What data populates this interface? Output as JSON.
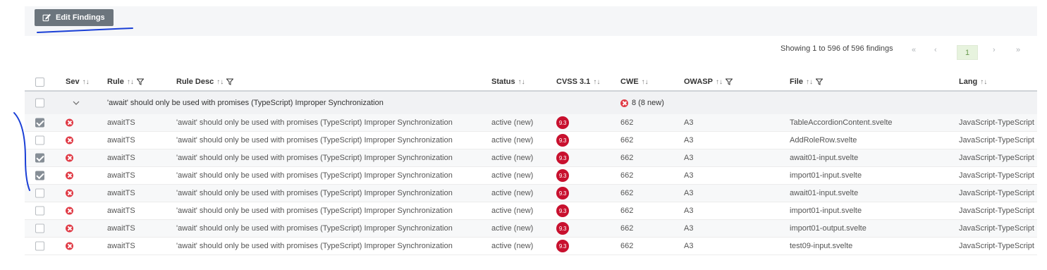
{
  "toolbar": {
    "edit_label": "Edit Findings",
    "edit_icon": "edit-icon"
  },
  "pager": {
    "summary": "Showing 1 to 596 of 596 findings",
    "first": "«",
    "prev": "‹",
    "current": "1",
    "next": "›",
    "last": "»"
  },
  "columns": {
    "sev": "Sev",
    "rule": "Rule",
    "rule_desc": "Rule Desc",
    "status": "Status",
    "cvss": "CVSS 3.1",
    "cwe": "CWE",
    "owasp": "OWASP",
    "file": "File",
    "lang": "Lang",
    "sort_glyph": "↑↓"
  },
  "group": {
    "title": "'await' should only be used with promises (TypeScript) Improper Synchronization",
    "count": "8 (8 new)"
  },
  "rows": [
    {
      "checked": true,
      "rule": "awaitTS",
      "desc": "'await' should only be used with promises (TypeScript) Improper Synchronization",
      "status": "active (new)",
      "cvss": "9.3",
      "cwe": "662",
      "owasp": "A3",
      "file": "TableAccordionContent.svelte",
      "lang": "JavaScript-TypeScript"
    },
    {
      "checked": false,
      "rule": "awaitTS",
      "desc": "'await' should only be used with promises (TypeScript) Improper Synchronization",
      "status": "active (new)",
      "cvss": "9.3",
      "cwe": "662",
      "owasp": "A3",
      "file": "AddRoleRow.svelte",
      "lang": "JavaScript-TypeScript"
    },
    {
      "checked": true,
      "rule": "awaitTS",
      "desc": "'await' should only be used with promises (TypeScript) Improper Synchronization",
      "status": "active (new)",
      "cvss": "9.3",
      "cwe": "662",
      "owasp": "A3",
      "file": "await01-input.svelte",
      "lang": "JavaScript-TypeScript"
    },
    {
      "checked": true,
      "rule": "awaitTS",
      "desc": "'await' should only be used with promises (TypeScript) Improper Synchronization",
      "status": "active (new)",
      "cvss": "9.3",
      "cwe": "662",
      "owasp": "A3",
      "file": "import01-input.svelte",
      "lang": "JavaScript-TypeScript"
    },
    {
      "checked": false,
      "rule": "awaitTS",
      "desc": "'await' should only be used with promises (TypeScript) Improper Synchronization",
      "status": "active (new)",
      "cvss": "9.3",
      "cwe": "662",
      "owasp": "A3",
      "file": "await01-input.svelte",
      "lang": "JavaScript-TypeScript"
    },
    {
      "checked": false,
      "rule": "awaitTS",
      "desc": "'await' should only be used with promises (TypeScript) Improper Synchronization",
      "status": "active (new)",
      "cvss": "9.3",
      "cwe": "662",
      "owasp": "A3",
      "file": "import01-input.svelte",
      "lang": "JavaScript-TypeScript"
    },
    {
      "checked": false,
      "rule": "awaitTS",
      "desc": "'await' should only be used with promises (TypeScript) Improper Synchronization",
      "status": "active (new)",
      "cvss": "9.3",
      "cwe": "662",
      "owasp": "A3",
      "file": "import01-output.svelte",
      "lang": "JavaScript-TypeScript"
    },
    {
      "checked": false,
      "rule": "awaitTS",
      "desc": "'await' should only be used with promises (TypeScript) Improper Synchronization",
      "status": "active (new)",
      "cvss": "9.3",
      "cwe": "662",
      "owasp": "A3",
      "file": "test09-input.svelte",
      "lang": "JavaScript-TypeScript"
    }
  ],
  "colors": {
    "annotation": "#1a3fd6",
    "severity": "#e03b46",
    "cvss": "#c8102e",
    "button": "#6c757d"
  }
}
